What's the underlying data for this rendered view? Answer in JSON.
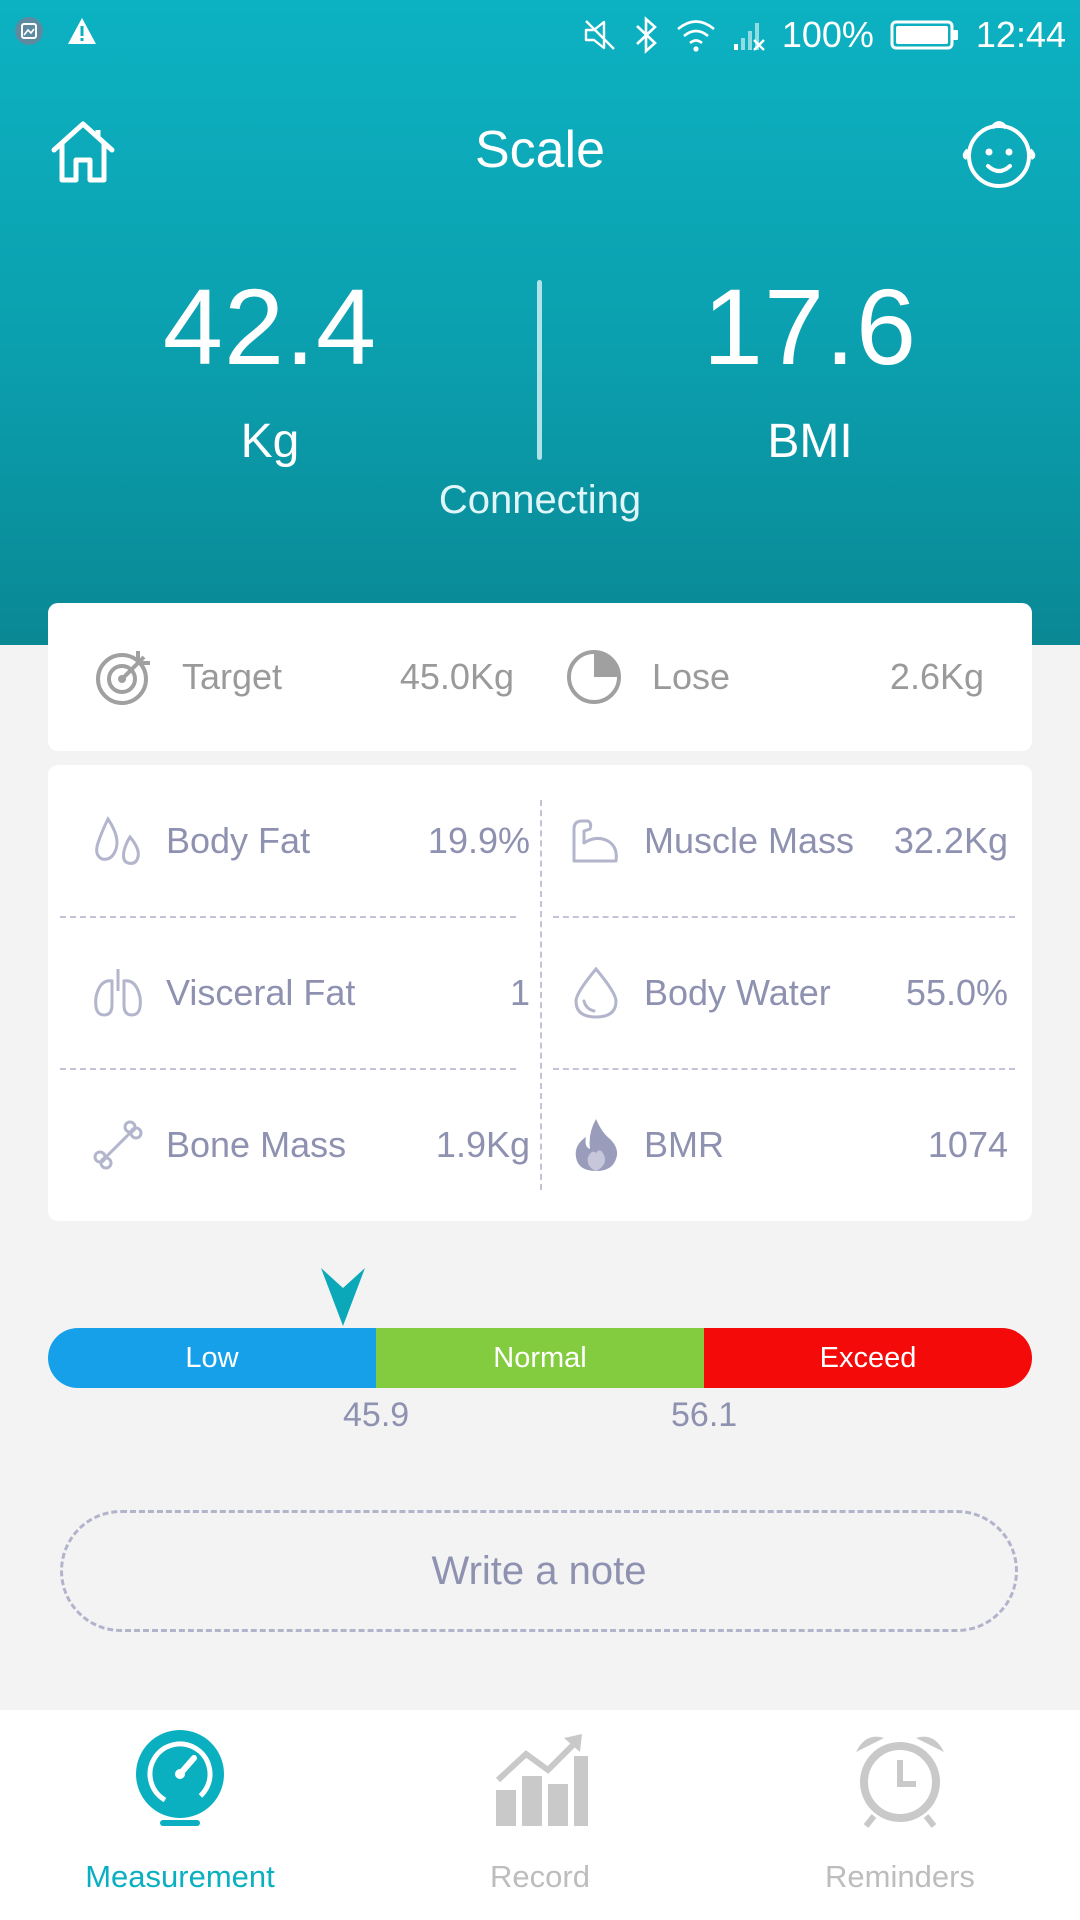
{
  "status_bar": {
    "battery": "100%",
    "time": "12:44"
  },
  "topbar": {
    "title": "Scale"
  },
  "measurement": {
    "weight": {
      "value": "42.4",
      "unit": "Kg"
    },
    "bmi": {
      "value": "17.6",
      "unit": "BMI"
    },
    "status": "Connecting"
  },
  "goal": {
    "target": {
      "label": "Target",
      "value": "45.0Kg"
    },
    "lose": {
      "label": "Lose",
      "value": "2.6Kg"
    }
  },
  "metrics": [
    {
      "label": "Body Fat",
      "value": "19.9%",
      "icon": "body-fat-icon"
    },
    {
      "label": "Muscle Mass",
      "value": "32.2Kg",
      "icon": "muscle-icon"
    },
    {
      "label": "Visceral Fat",
      "value": "1",
      "icon": "lungs-icon"
    },
    {
      "label": "Body Water",
      "value": "55.0%",
      "icon": "water-drop-icon"
    },
    {
      "label": "Bone Mass",
      "value": "1.9Kg",
      "icon": "bone-icon"
    },
    {
      "label": "BMR",
      "value": "1074",
      "icon": "flame-icon"
    }
  ],
  "range": {
    "segments": [
      "Low",
      "Normal",
      "Exceed"
    ],
    "thresholds": [
      "45.9",
      "56.1"
    ],
    "colors": {
      "low": "#17a0ea",
      "normal": "#84cc3f",
      "exceed": "#f50a0a"
    }
  },
  "note": {
    "placeholder": "Write a note"
  },
  "nav": [
    {
      "label": "Measurement",
      "active": true
    },
    {
      "label": "Record",
      "active": false
    },
    {
      "label": "Reminders",
      "active": false
    }
  ],
  "colors": {
    "accent": "#0ab0c0",
    "text_muted": "#8e91b0"
  }
}
